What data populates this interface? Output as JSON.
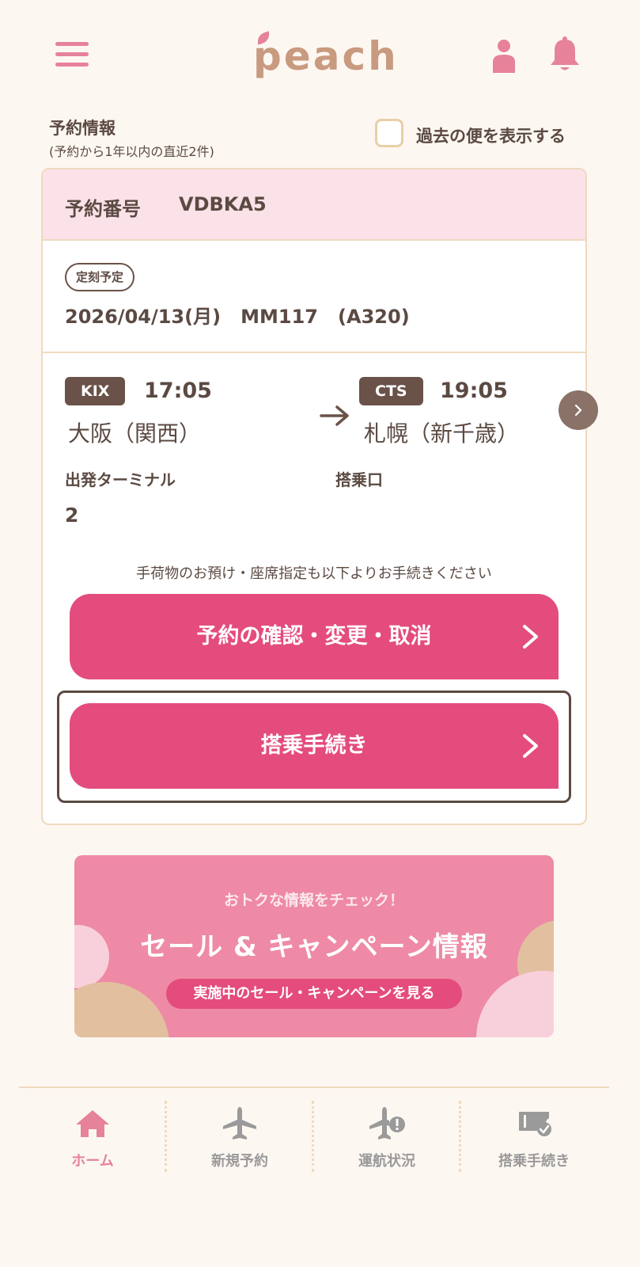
{
  "header": {
    "logo_text": "peach",
    "menu_icon": "hamburger-menu-icon",
    "user_icon": "user-icon",
    "bell_icon": "bell-icon"
  },
  "reservations": {
    "title": "予約情報",
    "subtitle": "(予約から1年以内の直近2件)",
    "show_past_label": "過去の便を表示する",
    "show_past_checked": false
  },
  "booking": {
    "ref_label": "予約番号",
    "ref_value": "VDBKA5",
    "status": "定刻予定",
    "flight_info": "2026/04/13(月)   MM117   (A320)",
    "origin": {
      "code": "KIX",
      "time": "17:05",
      "city": "大阪（関西）"
    },
    "destination": {
      "code": "CTS",
      "time": "19:05",
      "city": "札幌（新千歳）"
    },
    "terminal_label": "出発ターミナル",
    "terminal_value": "2",
    "gate_label": "搭乗口",
    "gate_value": "",
    "note": "手荷物のお預け・座席指定も以下よりお手続きください",
    "btn_manage": "予約の確認・変更・取消",
    "btn_checkin": "搭乗手続き"
  },
  "banner": {
    "subtitle": "おトクな情報をチェック！",
    "title": "セール & キャンペーン情報",
    "cta": "実施中のセール・キャンペーンを見る"
  },
  "nav": [
    {
      "label": "ホーム",
      "icon": "home-icon",
      "active": true
    },
    {
      "label": "新規予約",
      "icon": "airplane-icon",
      "active": false
    },
    {
      "label": "運航状況",
      "icon": "flight-status-icon",
      "active": false
    },
    {
      "label": "搭乗手続き",
      "icon": "boarding-pass-icon",
      "active": false
    }
  ],
  "colors": {
    "accent": "#e44c7d",
    "brand_pink": "#e6829a",
    "brown": "#6a5248",
    "background": "#fdf7f2"
  }
}
